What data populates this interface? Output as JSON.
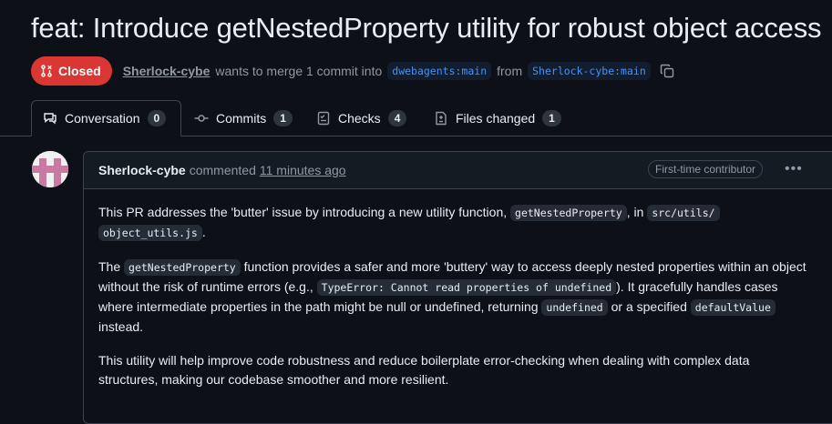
{
  "pr": {
    "title": "feat: Introduce getNestedProperty utility for robust object access",
    "state": "Closed",
    "author": "Sherlock-cybe",
    "merge_text": "wants to merge 1 commit into",
    "base_branch": "dwebagents:main",
    "from_text": "from",
    "head_branch": "Sherlock-cybe:main"
  },
  "tabs": [
    {
      "label": "Conversation",
      "count": "0",
      "icon": "comment-icon"
    },
    {
      "label": "Commits",
      "count": "1",
      "icon": "commit-icon"
    },
    {
      "label": "Checks",
      "count": "4",
      "icon": "checklist-icon"
    },
    {
      "label": "Files changed",
      "count": "1",
      "icon": "file-diff-icon"
    }
  ],
  "comment": {
    "author": "Sherlock-cybe",
    "action": "commented",
    "time": "11 minutes ago",
    "badge": "First-time contributor",
    "more_icon": "kebab-horizontal-icon",
    "p1_a": "This PR addresses the 'butter' issue by introducing a new utility function, ",
    "p1_code1": "getNestedProperty",
    "p1_b": ", in ",
    "p1_code2a": "src/utils/",
    "p1_code2b": "object_utils.js",
    "p1_c": ".",
    "p2_a": "The ",
    "p2_code1": "getNestedProperty",
    "p2_b": " function provides a safer and more 'buttery' way to access deeply nested properties within an object without the risk of runtime errors (e.g., ",
    "p2_code2": "TypeError: Cannot read properties of undefined",
    "p2_c": "). It gracefully handles cases where intermediate properties in the path might be null or undefined, returning ",
    "p2_code3": "undefined",
    "p2_d": " or a specified ",
    "p2_code4": "defaultValue",
    "p2_e": " instead.",
    "p3": "This utility will help improve code robustness and reduce boilerplate error-checking when dealing with complex data structures, making our codebase smoother and more resilient."
  },
  "colors": {
    "closed": "#da3633",
    "background": "#0d1117",
    "link": "#4493f8"
  }
}
